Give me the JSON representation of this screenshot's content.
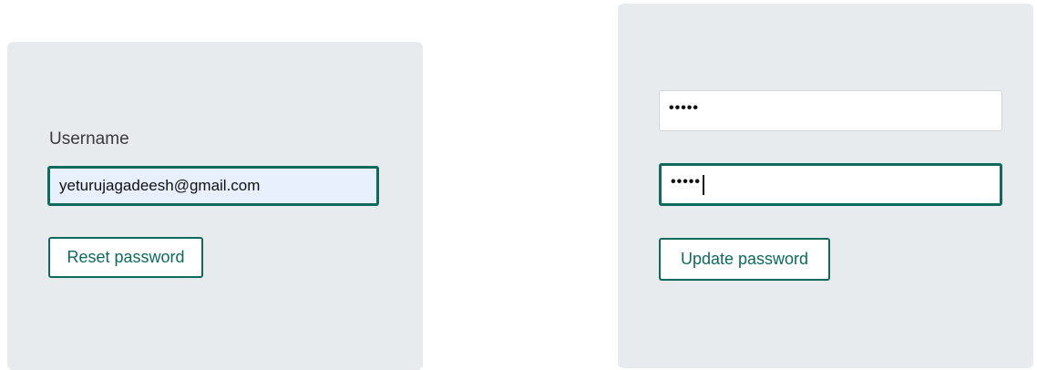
{
  "reset_form": {
    "username_label": "Username",
    "username_value": "yeturujagadeesh@gmail.com",
    "reset_button_label": "Reset password"
  },
  "update_form": {
    "password_value": "•••••",
    "confirm_value": "•••••",
    "update_button_label": "Update password"
  },
  "colors": {
    "panel_background": "#e8ebee",
    "accent": "#0d6a5c",
    "autofill_background": "#e8f0fe"
  }
}
